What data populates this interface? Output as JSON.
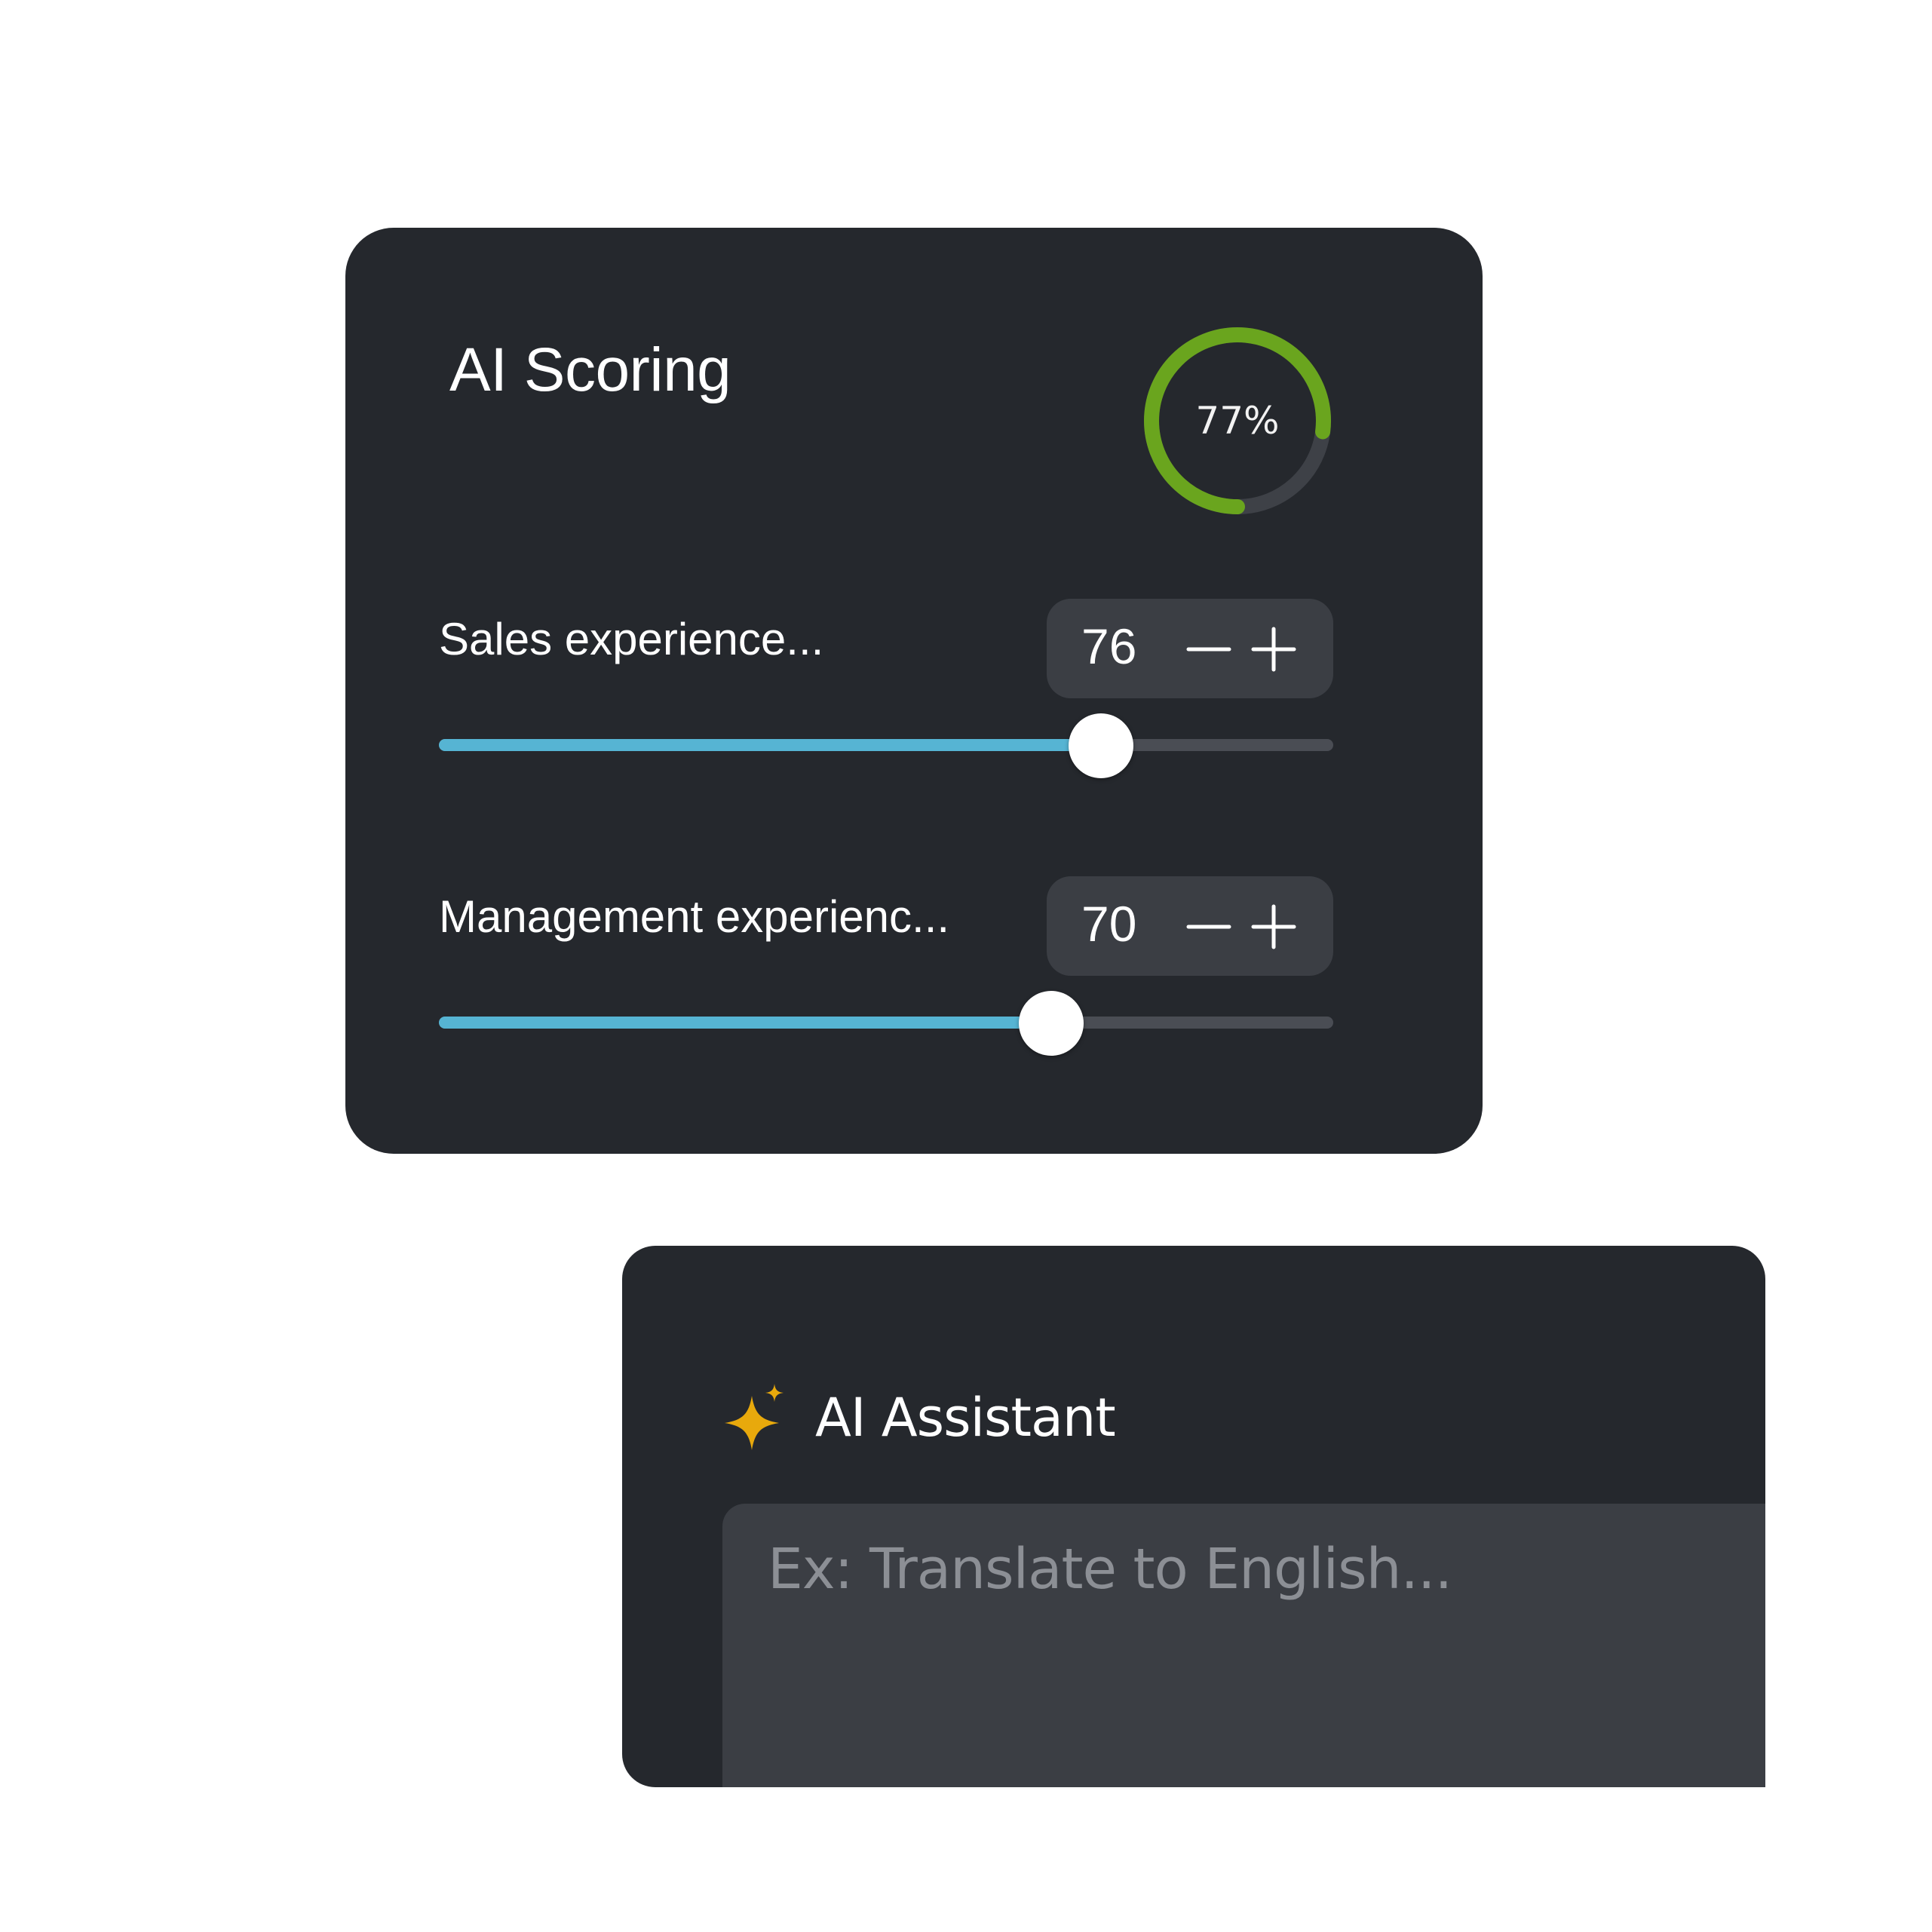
{
  "scoring": {
    "title": "AI Scoring",
    "overall_score_label": "77%",
    "overall_score_fraction": 0.77,
    "ring_color": "#6aa51e",
    "criteria": [
      {
        "label": "Sales experience...",
        "value": "76",
        "slider_fraction": 0.74
      },
      {
        "label": "Management experienc...",
        "value": "70",
        "slider_fraction": 0.685
      }
    ],
    "slider_fill_color": "#56b4d3"
  },
  "assistant": {
    "title": "AI Assistant",
    "icon": "sparkle-icon",
    "icon_color": "#e8a90c",
    "prompt_placeholder": "Ex: Translate to English...",
    "prompt_value": ""
  }
}
